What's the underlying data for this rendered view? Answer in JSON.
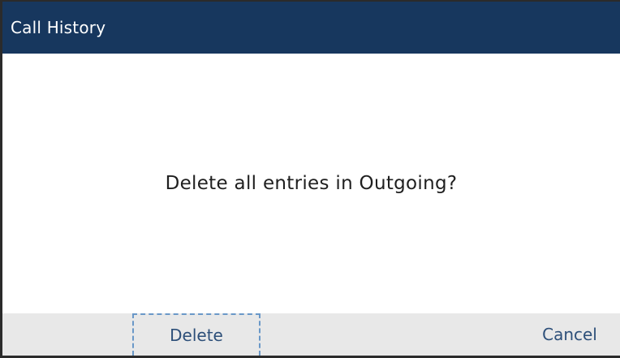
{
  "window": {
    "title": "Call History"
  },
  "dialog": {
    "message": "Delete all entries in Outgoing?"
  },
  "softkeys": {
    "delete_label": "Delete",
    "cancel_label": "Cancel"
  },
  "colors": {
    "titlebar": "#17375e",
    "softkey_bar": "#e8e8e8",
    "softkey_text": "#2d4f79",
    "focus_border": "#6a98c8"
  }
}
